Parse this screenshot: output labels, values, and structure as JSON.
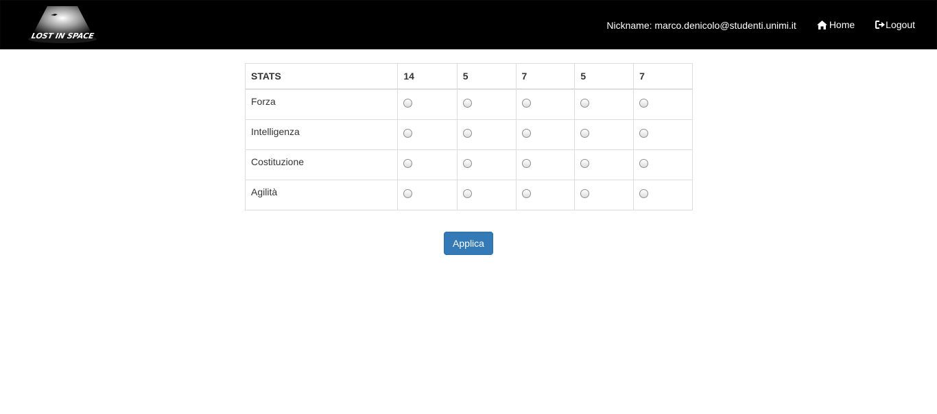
{
  "header": {
    "logo_text": "LOST IN SPACE",
    "nickname": "Nickname: marco.denicolo@studenti.unimi.it",
    "home_label": "Home",
    "logout_label": "Logout"
  },
  "stats_table": {
    "header_label": "STATS",
    "column_values": [
      "14",
      "5",
      "7",
      "5",
      "7"
    ],
    "rows": [
      {
        "label": "Forza"
      },
      {
        "label": "Intelligenza"
      },
      {
        "label": "Costituzione"
      },
      {
        "label": "Agilità"
      }
    ]
  },
  "apply_button": {
    "label": "Applica"
  },
  "colors": {
    "navbar_bg": "#000000",
    "primary": "#337ab7",
    "table_border": "#dddddd"
  }
}
